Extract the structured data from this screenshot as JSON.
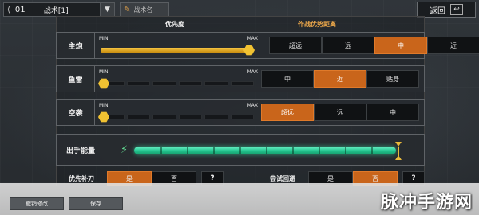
{
  "topbar": {
    "slot_number": "01",
    "slot_label": "战术[1]",
    "dropdown_icon": "chevron-down-icon",
    "name_placeholder": "战术名",
    "back_label": "返回"
  },
  "headers": {
    "priority": "优先度",
    "range": "作战优势距离"
  },
  "rows": [
    {
      "label": "主炮",
      "min": "MIN",
      "max": "MAX",
      "level": 1.0,
      "options": [
        "超远",
        "远",
        "中",
        "近"
      ],
      "selected": "中"
    },
    {
      "label": "鱼雷",
      "min": "MIN",
      "max": "MAX",
      "level": 0.0,
      "options": [
        "中",
        "近",
        "贴身"
      ],
      "selected": "近"
    },
    {
      "label": "空袭",
      "min": "MIN",
      "max": "MAX",
      "level": 0.0,
      "options": [
        "超远",
        "远",
        "中"
      ],
      "selected": "超远"
    }
  ],
  "energy": {
    "label": "出手能量",
    "level": 1.0,
    "icon": "lightning-icon"
  },
  "toggles": [
    {
      "label": "优先补刀",
      "yes": "是",
      "no": "否",
      "help": "?",
      "selected": "是"
    },
    {
      "label": "尝试回避",
      "yes": "是",
      "no": "否",
      "help": "?",
      "selected": "否"
    }
  ],
  "bottom": {
    "revert_label": "撤销修改",
    "save_label": "保存"
  },
  "watermark": "脉冲手游网",
  "colors": {
    "accent": "#c9651b",
    "slider": "#f1c232",
    "energy": "#26c791"
  }
}
